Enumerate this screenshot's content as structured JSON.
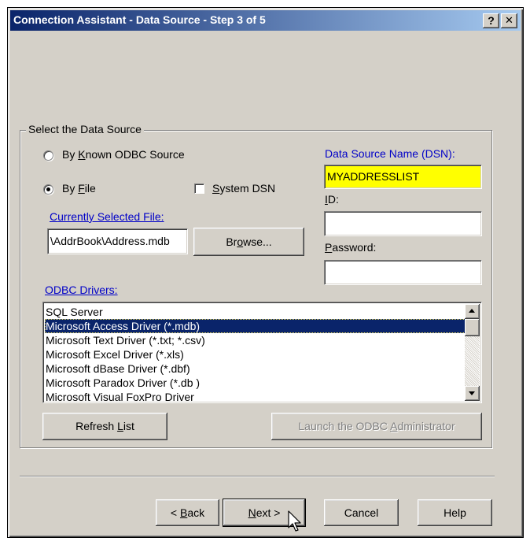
{
  "window": {
    "title": "Connection Assistant - Data Source - Step 3 of 5",
    "help_button": "?",
    "close_button": "✕"
  },
  "group": {
    "legend": "Select the Data Source"
  },
  "source": {
    "known_odbc": {
      "before": "By ",
      "accel": "K",
      "after": "nown ODBC Source",
      "checked": false
    },
    "by_file": {
      "before": "By ",
      "accel": "F",
      "after": "ile",
      "checked": true
    },
    "system_dsn": {
      "accel": "S",
      "after": "ystem DSN",
      "checked": false
    }
  },
  "file": {
    "label_accel": "C",
    "label_rest": "urrently Selected File:",
    "value": "\\AddrBook\\Address.mdb",
    "browse_before": "Br",
    "browse_accel": "o",
    "browse_after": "wse..."
  },
  "dsn": {
    "label": "Data Source Name (DSN):",
    "value": "MYADDRESSLIST",
    "highlight": "#ffff00"
  },
  "id": {
    "label_accel": "I",
    "label_rest": "D:",
    "value": ""
  },
  "password": {
    "label_accel": "P",
    "label_rest": "assword:",
    "value": ""
  },
  "drivers": {
    "label_accel": "O",
    "label_rest": "DBC Drivers:",
    "items": [
      "SQL Server",
      "Microsoft Access Driver (*.mdb)",
      "Microsoft Text Driver (*.txt; *.csv)",
      "Microsoft Excel Driver (*.xls)",
      "Microsoft dBase Driver (*.dbf)",
      "Microsoft Paradox Driver (*.db )",
      "Microsoft Visual FoxPro Driver"
    ],
    "selected_index": 1
  },
  "refresh": {
    "before": "Refresh ",
    "accel": "L",
    "after": "ist"
  },
  "launch": {
    "before": "Launch the ODBC ",
    "accel": "A",
    "after": "dministrator"
  },
  "nav": {
    "back": {
      "before": "< ",
      "accel": "B",
      "after": "ack"
    },
    "next": {
      "accel": "N",
      "after": "ext >"
    },
    "cancel": "Cancel",
    "help": "Help"
  },
  "colors": {
    "face": "#d4d0c8",
    "title_start": "#0a246a",
    "title_end": "#a6caf0",
    "link": "#0000c8",
    "selection": "#0a246a"
  },
  "icons": {
    "cursor": "arrow-pointer-icon",
    "scroll_up": "arrow-up-icon",
    "scroll_down": "arrow-down-icon"
  }
}
